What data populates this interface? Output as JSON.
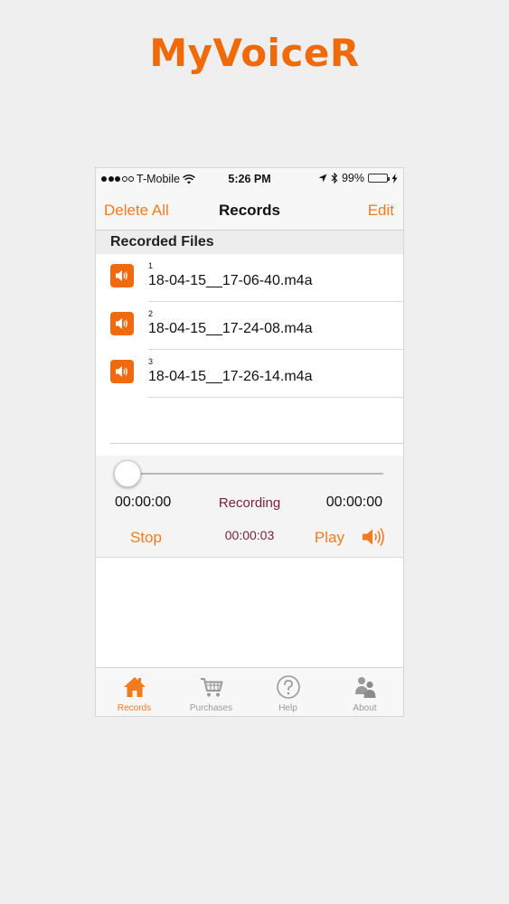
{
  "app": {
    "title": "MyVoiceR"
  },
  "status_bar": {
    "carrier": "T-Mobile",
    "time": "5:26 PM",
    "battery": "99%"
  },
  "nav": {
    "left_label": "Delete All",
    "title": "Records",
    "right_label": "Edit"
  },
  "list": {
    "section_title": "Recorded Files",
    "items": [
      {
        "index": "1",
        "name": "18-04-15__17-06-40.m4a"
      },
      {
        "index": "2",
        "name": "18-04-15__17-24-08.m4a"
      },
      {
        "index": "3",
        "name": "18-04-15__17-26-14.m4a"
      }
    ]
  },
  "player": {
    "time_current": "00:00:00",
    "status": "Recording",
    "time_total": "00:00:00",
    "stop_label": "Stop",
    "elapsed": "00:00:03",
    "play_label": "Play",
    "progress": 0
  },
  "tabs": [
    {
      "label": "Records",
      "icon": "house-icon",
      "active": true
    },
    {
      "label": "Purchases",
      "icon": "cart-icon",
      "active": false
    },
    {
      "label": "Help",
      "icon": "question-icon",
      "active": false
    },
    {
      "label": "About",
      "icon": "people-icon",
      "active": false
    }
  ],
  "colors": {
    "accent": "#f27b1f",
    "brand": "#f06a0a",
    "status_text": "#7a1f3b",
    "inactive_tab": "#9a9a9a"
  }
}
